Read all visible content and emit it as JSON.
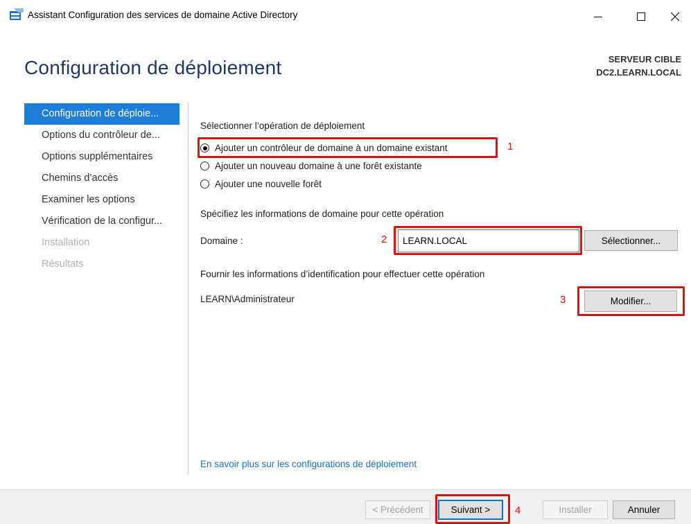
{
  "window": {
    "title": "Assistant Configuration des services de domaine Active Directory",
    "icon": "server-wizard-icon",
    "controls": [
      "minimize",
      "maximize",
      "close"
    ]
  },
  "header": {
    "page_title": "Configuration de déploiement",
    "target_label": "SERVEUR CIBLE",
    "target_name": "DC2.LEARN.LOCAL"
  },
  "nav": {
    "items": [
      {
        "label": "Configuration de déploie...",
        "state": "active"
      },
      {
        "label": "Options du contrôleur de...",
        "state": "normal"
      },
      {
        "label": "Options supplémentaires",
        "state": "normal"
      },
      {
        "label": "Chemins d’accès",
        "state": "normal"
      },
      {
        "label": "Examiner les options",
        "state": "normal"
      },
      {
        "label": "Vérification de la configur...",
        "state": "normal"
      },
      {
        "label": "Installation",
        "state": "disabled"
      },
      {
        "label": "Résultats",
        "state": "disabled"
      }
    ]
  },
  "main": {
    "operation_heading": "Sélectionner l’opération de déploiement",
    "options": [
      {
        "label": "Ajouter un contrôleur de domaine à un domaine existant",
        "checked": true
      },
      {
        "label": "Ajouter un nouveau domaine à une forêt existante",
        "checked": false
      },
      {
        "label": "Ajouter une nouvelle forêt",
        "checked": false
      }
    ],
    "domain_heading": "Spécifiez les informations de domaine pour cette opération",
    "domain_label": "Domaine :",
    "domain_value": "LEARN.LOCAL",
    "select_button": "Sélectionner...",
    "credentials_heading": "Fournir les informations d’identification pour effectuer cette opération",
    "credentials_user": "LEARN\\Administrateur",
    "modify_button": "Modifier...",
    "learn_more_link": "En savoir plus sur les configurations de déploiement"
  },
  "footer": {
    "previous": "< Précédent",
    "next": "Suivant >",
    "install": "Installer",
    "cancel": "Annuler"
  },
  "annotations": {
    "n1": "1",
    "n2": "2",
    "n3": "3",
    "n4": "4",
    "color": "#e01010"
  },
  "colors": {
    "title_blue": "#1e3966",
    "nav_active": "#1c7ed6",
    "link": "#1a6fc7",
    "footer_bg": "#f0f0f0"
  }
}
